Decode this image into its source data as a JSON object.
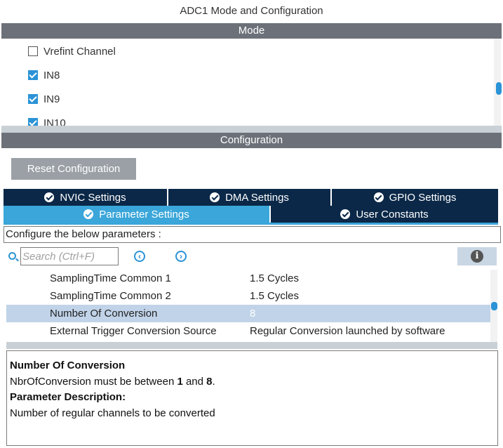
{
  "window": {
    "title": "ADC1 Mode and Configuration"
  },
  "mode": {
    "header": "Mode",
    "items": [
      {
        "label": "Vrefint Channel",
        "checked": false
      },
      {
        "label": "IN8",
        "checked": true
      },
      {
        "label": "IN9",
        "checked": true
      },
      {
        "label": "IN10",
        "checked": true
      }
    ]
  },
  "configuration": {
    "header": "Configuration",
    "reset_label": "Reset Configuration"
  },
  "tabs": {
    "row1": [
      "NVIC Settings",
      "DMA Settings",
      "GPIO Settings"
    ],
    "row2": [
      "Parameter Settings",
      "User Constants"
    ],
    "active": "Parameter Settings"
  },
  "params": {
    "hint": "Configure the below parameters :",
    "search_placeholder": "Search (Ctrl+F)",
    "rows": [
      {
        "name": "SamplingTime Common 1",
        "value": "1.5 Cycles"
      },
      {
        "name": "SamplingTime Common 2",
        "value": "1.5 Cycles"
      },
      {
        "name": "Number Of Conversion",
        "value": "8",
        "selected": true
      },
      {
        "name": "External Trigger Conversion Source",
        "value": "Regular Conversion launched by software"
      }
    ]
  },
  "description": {
    "title": "Number Of Conversion",
    "constraint_prefix": "NbrOfConversion must be between ",
    "min": "1",
    "between_and": " and ",
    "max": "8",
    "constraint_suffix": ".",
    "param_desc_label": "Parameter Description:",
    "param_desc_text": "Number of regular channels to be converted"
  },
  "icons": {
    "check": "checkmark-icon",
    "search": "search-icon",
    "prev": "previous-arrow-icon",
    "next": "next-arrow-icon",
    "info": "info-icon"
  },
  "colors": {
    "section_header": "#6c7179",
    "tab_dark": "#0b2848",
    "tab_active": "#3aa6d9",
    "accent": "#2b93d6",
    "selected_row": "#c0d3e8"
  }
}
